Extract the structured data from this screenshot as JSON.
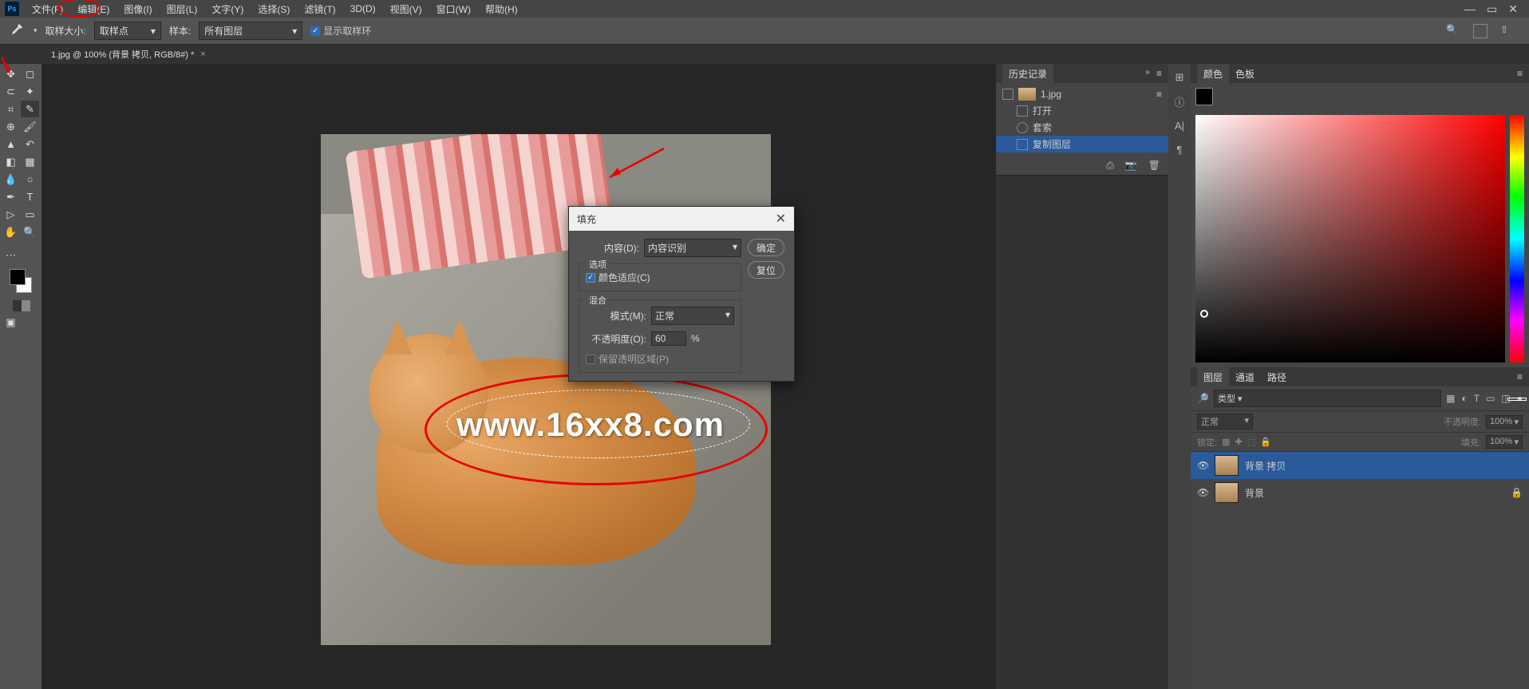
{
  "menu": {
    "file": "文件(F)",
    "edit": "编辑(E)",
    "image": "图像(I)",
    "layer": "图层(L)",
    "type": "文字(Y)",
    "select": "选择(S)",
    "filter": "滤镜(T)",
    "d3": "3D(D)",
    "view": "视图(V)",
    "window": "窗口(W)",
    "help": "帮助(H)"
  },
  "options": {
    "sample_size_label": "取样大小:",
    "sample_size_value": "取样点",
    "sample_label": "样本:",
    "sample_value": "所有图层",
    "show_ring": "显示取样环"
  },
  "doc": {
    "tab": "1.jpg @ 100% (背景 拷贝, RGB/8#) *"
  },
  "watermark_text": "www.16xx8.com",
  "dialog": {
    "title": "填充",
    "content_label": "内容(D):",
    "content_value": "内容识别",
    "options_group": "选项",
    "color_adapt": "颜色适应(C)",
    "blend_group": "混合",
    "mode_label": "模式(M):",
    "mode_value": "正常",
    "opacity_label": "不透明度(O):",
    "opacity_value": "60",
    "opacity_pct": "%",
    "preserve_trans": "保留透明区域(P)",
    "ok": "确定",
    "reset": "复位"
  },
  "history": {
    "title": "历史记录",
    "doc": "1.jpg",
    "items": [
      "打开",
      "套索",
      "复制图层"
    ]
  },
  "color_panel": {
    "tab1": "颜色",
    "tab2": "色板"
  },
  "layers": {
    "tab1": "图层",
    "tab2": "通道",
    "tab3": "路径",
    "filter_ph": "类型",
    "blend": "正常",
    "opacity_label": "不透明度:",
    "opacity_val": "100%",
    "lock_label": "锁定:",
    "fill_label": "填充:",
    "fill_val": "100%",
    "items": [
      {
        "name": "背景 拷贝",
        "locked": false,
        "selected": true
      },
      {
        "name": "背景",
        "locked": true,
        "selected": false
      }
    ]
  }
}
